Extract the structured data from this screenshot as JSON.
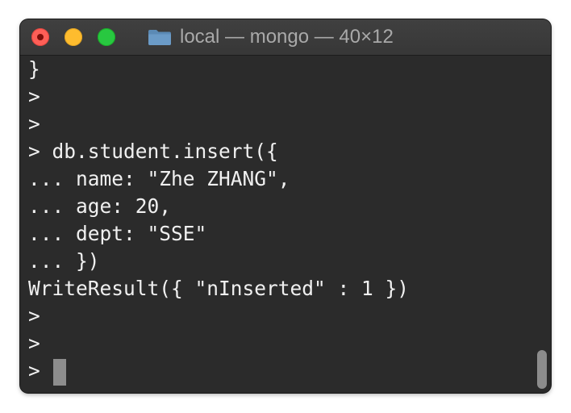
{
  "window": {
    "title": "local — mongo — 40×12"
  },
  "terminal": {
    "lines": [
      "}",
      ">",
      ">",
      "> db.student.insert({",
      "... name: \"Zhe ZHANG\",",
      "... age: 20,",
      "... dept: \"SSE\"",
      "... })",
      "WriteResult({ \"nInserted\" : 1 })",
      ">",
      ">",
      ">"
    ]
  },
  "colors": {
    "background": "#2b2b2b",
    "text": "#f0f0f0",
    "close": "#fe5f57",
    "minimize": "#febc2e",
    "maximize": "#28c840",
    "cursor": "#8d8d8d"
  },
  "icons": {
    "title": "folder-icon"
  }
}
